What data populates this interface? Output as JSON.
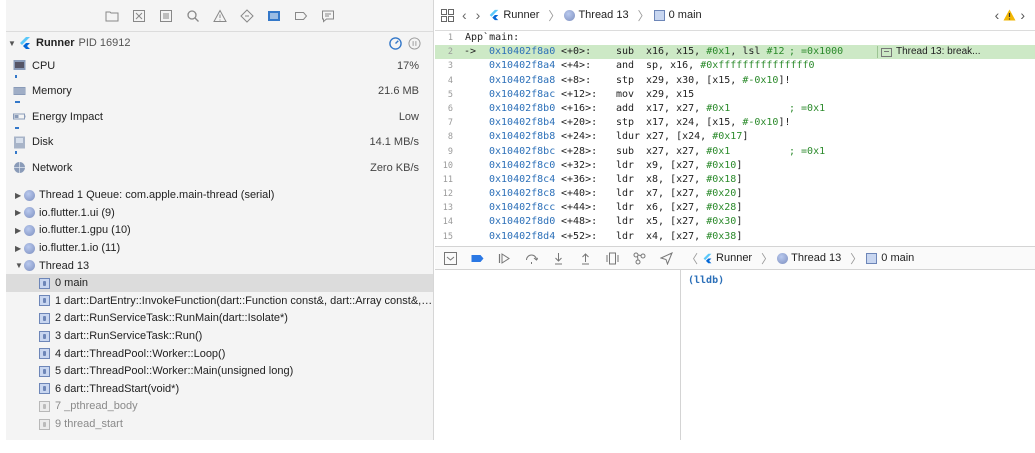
{
  "navigator": {
    "process": {
      "name": "Runner",
      "pid": "PID 16912"
    },
    "gauges": [
      {
        "label": "CPU",
        "value": "17%"
      },
      {
        "label": "Memory",
        "value": "21.6 MB"
      },
      {
        "label": "Energy Impact",
        "value": "Low"
      },
      {
        "label": "Disk",
        "value": "14.1 MB/s"
      },
      {
        "label": "Network",
        "value": "Zero KB/s"
      }
    ],
    "threads": [
      "Thread 1 Queue: com.apple.main-thread (serial)",
      "io.flutter.1.ui (9)",
      "io.flutter.1.gpu (10)",
      "io.flutter.1.io (11)",
      "Thread 13"
    ],
    "frames": [
      "0 main",
      "1 dart::DartEntry::InvokeFunction(dart::Function const&, dart::Array const&, d...",
      "2 dart::RunServiceTask::RunMain(dart::Isolate*)",
      "3 dart::RunServiceTask::Run()",
      "4 dart::ThreadPool::Worker::Loop()",
      "5 dart::ThreadPool::Worker::Main(unsigned long)",
      "6 dart::ThreadStart(void*)",
      "7 _pthread_body",
      "9 thread_start"
    ]
  },
  "jump_bar": {
    "app": "Runner",
    "thread": "Thread 13",
    "frame": "0 main"
  },
  "disassembly": {
    "header": "App`main:",
    "lines": [
      {
        "ln": "2",
        "arrow": "->",
        "addr": "0x10402f8a0",
        "off": "<+0>:",
        "mn": "sub",
        "ops": [
          "x16, x15, ",
          "#0x1",
          ", lsl ",
          "#12"
        ],
        "cm": "; =0x1000"
      },
      {
        "ln": "3",
        "arrow": "",
        "addr": "0x10402f8a4",
        "off": "<+4>:",
        "mn": "and",
        "ops": [
          "sp, x16, ",
          "#0xfffffffffffffff0"
        ],
        "cm": ""
      },
      {
        "ln": "4",
        "arrow": "",
        "addr": "0x10402f8a8",
        "off": "<+8>:",
        "mn": "stp",
        "ops": [
          "x29, x30, [x15, ",
          "#-0x10",
          "]!"
        ],
        "cm": ""
      },
      {
        "ln": "5",
        "arrow": "",
        "addr": "0x10402f8ac",
        "off": "<+12>:",
        "mn": "mov",
        "ops": [
          "x29, x15"
        ],
        "cm": ""
      },
      {
        "ln": "6",
        "arrow": "",
        "addr": "0x10402f8b0",
        "off": "<+16>:",
        "mn": "add",
        "ops": [
          "x17, x27, ",
          "#0x1"
        ],
        "cm": "; =0x1"
      },
      {
        "ln": "7",
        "arrow": "",
        "addr": "0x10402f8b4",
        "off": "<+20>:",
        "mn": "stp",
        "ops": [
          "x17, x24, [x15, ",
          "#-0x10",
          "]!"
        ],
        "cm": ""
      },
      {
        "ln": "8",
        "arrow": "",
        "addr": "0x10402f8b8",
        "off": "<+24>:",
        "mn": "ldur",
        "ops": [
          "x27, [x24, ",
          "#0x17",
          "]"
        ],
        "cm": ""
      },
      {
        "ln": "9",
        "arrow": "",
        "addr": "0x10402f8bc",
        "off": "<+28>:",
        "mn": "sub",
        "ops": [
          "x27, x27, ",
          "#0x1"
        ],
        "cm": "; =0x1"
      },
      {
        "ln": "10",
        "arrow": "",
        "addr": "0x10402f8c0",
        "off": "<+32>:",
        "mn": "ldr",
        "ops": [
          "x9, [x27, ",
          "#0x10",
          "]"
        ],
        "cm": ""
      },
      {
        "ln": "11",
        "arrow": "",
        "addr": "0x10402f8c4",
        "off": "<+36>:",
        "mn": "ldr",
        "ops": [
          "x8, [x27, ",
          "#0x18",
          "]"
        ],
        "cm": ""
      },
      {
        "ln": "12",
        "arrow": "",
        "addr": "0x10402f8c8",
        "off": "<+40>:",
        "mn": "ldr",
        "ops": [
          "x7, [x27, ",
          "#0x20",
          "]"
        ],
        "cm": ""
      },
      {
        "ln": "13",
        "arrow": "",
        "addr": "0x10402f8cc",
        "off": "<+44>:",
        "mn": "ldr",
        "ops": [
          "x6, [x27, ",
          "#0x28",
          "]"
        ],
        "cm": ""
      },
      {
        "ln": "14",
        "arrow": "",
        "addr": "0x10402f8d0",
        "off": "<+48>:",
        "mn": "ldr",
        "ops": [
          "x5, [x27, ",
          "#0x30",
          "]"
        ],
        "cm": ""
      },
      {
        "ln": "15",
        "arrow": "",
        "addr": "0x10402f8d4",
        "off": "<+52>:",
        "mn": "ldr",
        "ops": [
          "x4, [x27, ",
          "#0x38",
          "]"
        ],
        "cm": ""
      }
    ],
    "breakpoint_label": "Thread 13: break..."
  },
  "debug_bar": {
    "app": "Runner",
    "thread": "Thread 13",
    "frame": "0 main"
  },
  "console": {
    "prompt": "(lldb)"
  },
  "colors": {
    "accent": "#2b6fb8",
    "highlight": "#cde9c6",
    "number": "#2b8a2b"
  }
}
